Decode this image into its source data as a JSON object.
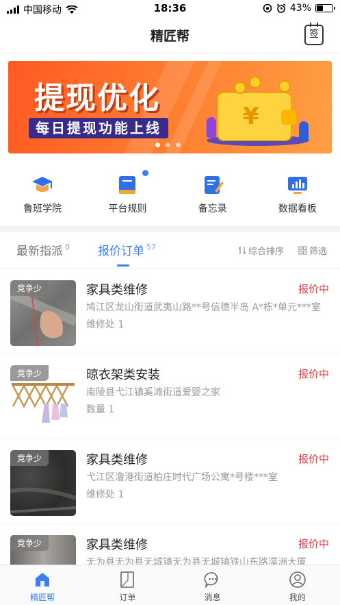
{
  "status_bar": {
    "carrier": "中国移动",
    "time": "18:36",
    "battery": "43%"
  },
  "header": {
    "title": "精匠帮",
    "sign_label": "签"
  },
  "banner": {
    "title": "提现优化",
    "subtitle": "每日提现功能上线",
    "currency": "¥"
  },
  "quick_menu": [
    {
      "label": "鲁班学院",
      "icon": "graduation-cap-icon"
    },
    {
      "label": "平台规则",
      "icon": "rulebook-icon"
    },
    {
      "label": "备忘录",
      "icon": "memo-icon"
    },
    {
      "label": "数据看板",
      "icon": "dashboard-icon"
    }
  ],
  "tabs": {
    "latest": {
      "label": "最新指派",
      "count": "0"
    },
    "quote": {
      "label": "报价订单",
      "count": "57"
    },
    "sort_label": "综合排序",
    "filter_label": "筛选"
  },
  "orders": [
    {
      "badge": "竞争少",
      "title": "家具类维修",
      "status": "报价中",
      "address": "鸠江区龙山街道武夷山路**号信德半岛 A*栋*单元***室",
      "count": "维修处 1"
    },
    {
      "badge": "竞争少",
      "title": "晾衣架类安装",
      "status": "报价中",
      "address": "南陵县弋江镇奚滩街道爱婴之家",
      "count": "数量 1"
    },
    {
      "badge": "竞争少",
      "title": "家具类维修",
      "status": "报价中",
      "address": "弋江区澛港街道柏庄时代广场公寓*号楼***室",
      "count": "维修处 1"
    },
    {
      "badge": "竞争少",
      "title": "家具类维修",
      "status": "报价中",
      "address": "无为县无为县无城镇无为县无城镇铁山东路濡洲大厦",
      "count": ""
    }
  ],
  "tabbar": [
    {
      "label": "精匠帮",
      "icon": "home-icon",
      "active": true
    },
    {
      "label": "订单",
      "icon": "order-icon",
      "active": false
    },
    {
      "label": "消息",
      "icon": "message-icon",
      "active": false
    },
    {
      "label": "我的",
      "icon": "profile-icon",
      "active": false
    }
  ],
  "colors": {
    "accent": "#3d7df6",
    "status_red": "#e8383d",
    "banner_orange": "#ff6a28"
  }
}
